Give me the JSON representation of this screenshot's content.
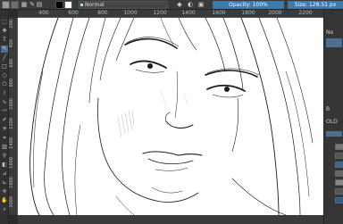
{
  "toolbar": {
    "blend_mode": "Normal",
    "opacity": "Opacity: 100%",
    "size": "Size: 128.51 px",
    "foreground_color": "#000000",
    "background_color": "#ffffff",
    "accent_color": "#3b7aae",
    "icons": [
      "eraser-icon",
      "reset-icon",
      "alpha-lock-icon",
      "brush-preset-icon"
    ]
  },
  "h_ruler": {
    "ticks": [
      "400",
      "600",
      "800",
      "1000",
      "1200",
      "1400",
      "1600",
      "1800",
      "2000",
      "2200"
    ]
  },
  "v_ruler": {
    "ticks": [
      "200",
      "400",
      "600",
      "800",
      "1000",
      "1200",
      "1400",
      "1600",
      "1800",
      "2000"
    ]
  },
  "toolbox": {
    "icons": [
      "select-icon",
      "transform-icon",
      "text-icon",
      "brush-icon",
      "line-icon",
      "rectangle-icon",
      "ellipse-icon",
      "polygon-icon",
      "polyline-icon",
      "bezier-icon",
      "freehand-path-icon",
      "dynamic-brush-icon",
      "multibrush-icon",
      "crop-icon",
      "gradient-icon",
      "color-picker-icon",
      "fill-icon",
      "assistant-icon",
      "measure-icon",
      "move-icon",
      "pan-icon",
      "zoom-icon"
    ]
  },
  "dock": {
    "label_top": "Ne",
    "label_layers": "B",
    "label_layer_name": "OLD"
  }
}
